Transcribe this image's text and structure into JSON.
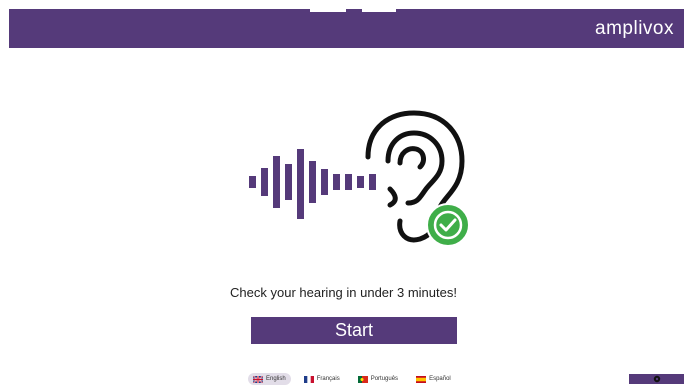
{
  "header": {
    "brand": "amplivox"
  },
  "main": {
    "headline": "Check your hearing in under 3 minutes!",
    "start_label": "Start"
  },
  "languages": [
    {
      "label": "English",
      "active": true
    },
    {
      "label": "Français",
      "active": false
    },
    {
      "label": "Português",
      "active": false
    },
    {
      "label": "Español",
      "active": false
    }
  ],
  "colors": {
    "brand_purple": "#553a7a",
    "check_green": "#3fae49"
  },
  "icons": {
    "hero": "ear-with-soundwave-icon",
    "check": "check-circle-icon",
    "settings": "gear-icon"
  }
}
